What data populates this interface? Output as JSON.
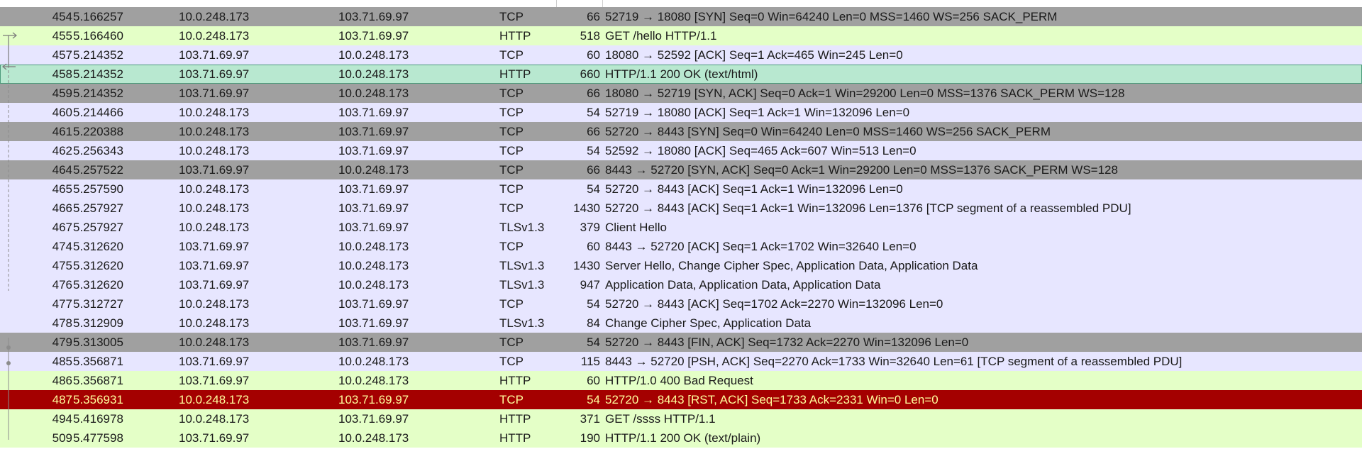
{
  "packets": [
    {
      "no": "454",
      "time": "5.166257",
      "src": "10.0.248.173",
      "dst": "103.71.69.97",
      "proto": "TCP",
      "len": "66",
      "info": "52719 → 18080 [SYN] Seq=0 Win=64240 Len=0 MSS=1460 WS=256 SACK_PERM",
      "style": "syn"
    },
    {
      "no": "455",
      "time": "5.166460",
      "src": "10.0.248.173",
      "dst": "103.71.69.97",
      "proto": "HTTP",
      "len": "518",
      "info": "GET /hello HTTP/1.1",
      "style": "http"
    },
    {
      "no": "457",
      "time": "5.214352",
      "src": "103.71.69.97",
      "dst": "10.0.248.173",
      "proto": "TCP",
      "len": "60",
      "info": "18080 → 52592 [ACK] Seq=1 Ack=465 Win=245 Len=0",
      "style": "tcp"
    },
    {
      "no": "458",
      "time": "5.214352",
      "src": "103.71.69.97",
      "dst": "10.0.248.173",
      "proto": "HTTP",
      "len": "660",
      "info": "HTTP/1.1 200 OK  (text/html)",
      "style": "selected"
    },
    {
      "no": "459",
      "time": "5.214352",
      "src": "103.71.69.97",
      "dst": "10.0.248.173",
      "proto": "TCP",
      "len": "66",
      "info": "18080 → 52719 [SYN, ACK] Seq=0 Ack=1 Win=29200 Len=0 MSS=1376 SACK_PERM WS=128",
      "style": "syn"
    },
    {
      "no": "460",
      "time": "5.214466",
      "src": "10.0.248.173",
      "dst": "103.71.69.97",
      "proto": "TCP",
      "len": "54",
      "info": "52719 → 18080 [ACK] Seq=1 Ack=1 Win=132096 Len=0",
      "style": "tcp"
    },
    {
      "no": "461",
      "time": "5.220388",
      "src": "10.0.248.173",
      "dst": "103.71.69.97",
      "proto": "TCP",
      "len": "66",
      "info": "52720 → 8443 [SYN] Seq=0 Win=64240 Len=0 MSS=1460 WS=256 SACK_PERM",
      "style": "syn"
    },
    {
      "no": "462",
      "time": "5.256343",
      "src": "10.0.248.173",
      "dst": "103.71.69.97",
      "proto": "TCP",
      "len": "54",
      "info": "52592 → 18080 [ACK] Seq=465 Ack=607 Win=513 Len=0",
      "style": "tcp"
    },
    {
      "no": "464",
      "time": "5.257522",
      "src": "103.71.69.97",
      "dst": "10.0.248.173",
      "proto": "TCP",
      "len": "66",
      "info": "8443 → 52720 [SYN, ACK] Seq=0 Ack=1 Win=29200 Len=0 MSS=1376 SACK_PERM WS=128",
      "style": "syn"
    },
    {
      "no": "465",
      "time": "5.257590",
      "src": "10.0.248.173",
      "dst": "103.71.69.97",
      "proto": "TCP",
      "len": "54",
      "info": "52720 → 8443 [ACK] Seq=1 Ack=1 Win=132096 Len=0",
      "style": "tcp"
    },
    {
      "no": "466",
      "time": "5.257927",
      "src": "10.0.248.173",
      "dst": "103.71.69.97",
      "proto": "TCP",
      "len": "1430",
      "info": "52720 → 8443 [ACK] Seq=1 Ack=1 Win=132096 Len=1376 [TCP segment of a reassembled PDU]",
      "style": "tcp"
    },
    {
      "no": "467",
      "time": "5.257927",
      "src": "10.0.248.173",
      "dst": "103.71.69.97",
      "proto": "TLSv1.3",
      "len": "379",
      "info": "Client Hello",
      "style": "tls"
    },
    {
      "no": "474",
      "time": "5.312620",
      "src": "103.71.69.97",
      "dst": "10.0.248.173",
      "proto": "TCP",
      "len": "60",
      "info": "8443 → 52720 [ACK] Seq=1 Ack=1702 Win=32640 Len=0",
      "style": "tcp"
    },
    {
      "no": "475",
      "time": "5.312620",
      "src": "103.71.69.97",
      "dst": "10.0.248.173",
      "proto": "TLSv1.3",
      "len": "1430",
      "info": "Server Hello, Change Cipher Spec, Application Data, Application Data",
      "style": "tls"
    },
    {
      "no": "476",
      "time": "5.312620",
      "src": "103.71.69.97",
      "dst": "10.0.248.173",
      "proto": "TLSv1.3",
      "len": "947",
      "info": "Application Data, Application Data, Application Data",
      "style": "tls"
    },
    {
      "no": "477",
      "time": "5.312727",
      "src": "10.0.248.173",
      "dst": "103.71.69.97",
      "proto": "TCP",
      "len": "54",
      "info": "52720 → 8443 [ACK] Seq=1702 Ack=2270 Win=132096 Len=0",
      "style": "tcp"
    },
    {
      "no": "478",
      "time": "5.312909",
      "src": "10.0.248.173",
      "dst": "103.71.69.97",
      "proto": "TLSv1.3",
      "len": "84",
      "info": "Change Cipher Spec, Application Data",
      "style": "tls"
    },
    {
      "no": "479",
      "time": "5.313005",
      "src": "10.0.248.173",
      "dst": "103.71.69.97",
      "proto": "TCP",
      "len": "54",
      "info": "52720 → 8443 [FIN, ACK] Seq=1732 Ack=2270 Win=132096 Len=0",
      "style": "syn"
    },
    {
      "no": "485",
      "time": "5.356871",
      "src": "103.71.69.97",
      "dst": "10.0.248.173",
      "proto": "TCP",
      "len": "115",
      "info": "8443 → 52720 [PSH, ACK] Seq=2270 Ack=1733 Win=32640 Len=61 [TCP segment of a reassembled PDU]",
      "style": "tcp"
    },
    {
      "no": "486",
      "time": "5.356871",
      "src": "103.71.69.97",
      "dst": "10.0.248.173",
      "proto": "HTTP",
      "len": "60",
      "info": "HTTP/1.0 400 Bad Request",
      "style": "http"
    },
    {
      "no": "487",
      "time": "5.356931",
      "src": "10.0.248.173",
      "dst": "103.71.69.97",
      "proto": "TCP",
      "len": "54",
      "info": "52720 → 8443 [RST, ACK] Seq=1733 Ack=2331 Win=0 Len=0",
      "style": "rst"
    },
    {
      "no": "494",
      "time": "5.416978",
      "src": "10.0.248.173",
      "dst": "103.71.69.97",
      "proto": "HTTP",
      "len": "371",
      "info": "GET /ssss HTTP/1.1",
      "style": "http"
    },
    {
      "no": "509",
      "time": "5.477598",
      "src": "103.71.69.97",
      "dst": "10.0.248.173",
      "proto": "HTTP",
      "len": "190",
      "info": "HTTP/1.1 200 OK  (text/plain)",
      "style": "http"
    }
  ]
}
